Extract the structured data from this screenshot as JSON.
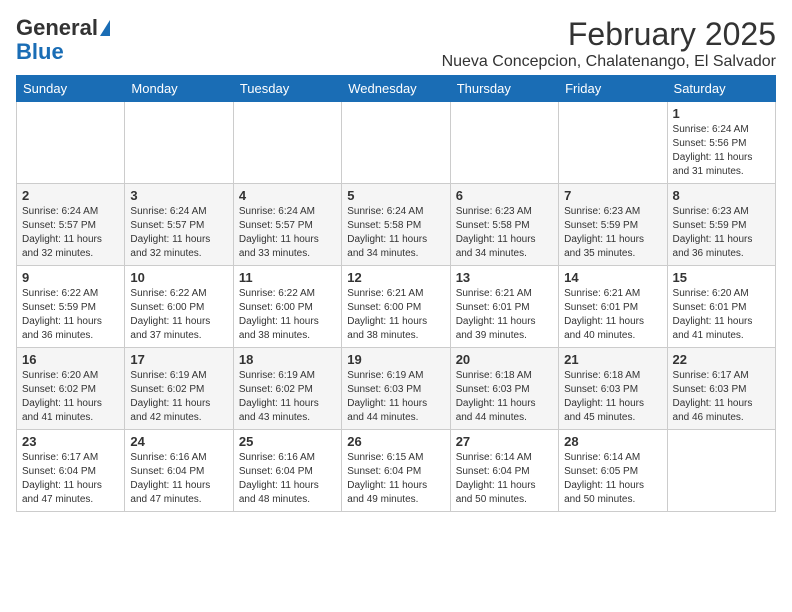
{
  "logo": {
    "general": "General",
    "blue": "Blue",
    "triangle": "▶"
  },
  "title": {
    "month": "February 2025",
    "location": "Nueva Concepcion, Chalatenango, El Salvador"
  },
  "headers": [
    "Sunday",
    "Monday",
    "Tuesday",
    "Wednesday",
    "Thursday",
    "Friday",
    "Saturday"
  ],
  "weeks": [
    [
      {
        "day": "",
        "info": ""
      },
      {
        "day": "",
        "info": ""
      },
      {
        "day": "",
        "info": ""
      },
      {
        "day": "",
        "info": ""
      },
      {
        "day": "",
        "info": ""
      },
      {
        "day": "",
        "info": ""
      },
      {
        "day": "1",
        "info": "Sunrise: 6:24 AM\nSunset: 5:56 PM\nDaylight: 11 hours and 31 minutes."
      }
    ],
    [
      {
        "day": "2",
        "info": "Sunrise: 6:24 AM\nSunset: 5:57 PM\nDaylight: 11 hours and 32 minutes."
      },
      {
        "day": "3",
        "info": "Sunrise: 6:24 AM\nSunset: 5:57 PM\nDaylight: 11 hours and 32 minutes."
      },
      {
        "day": "4",
        "info": "Sunrise: 6:24 AM\nSunset: 5:57 PM\nDaylight: 11 hours and 33 minutes."
      },
      {
        "day": "5",
        "info": "Sunrise: 6:24 AM\nSunset: 5:58 PM\nDaylight: 11 hours and 34 minutes."
      },
      {
        "day": "6",
        "info": "Sunrise: 6:23 AM\nSunset: 5:58 PM\nDaylight: 11 hours and 34 minutes."
      },
      {
        "day": "7",
        "info": "Sunrise: 6:23 AM\nSunset: 5:59 PM\nDaylight: 11 hours and 35 minutes."
      },
      {
        "day": "8",
        "info": "Sunrise: 6:23 AM\nSunset: 5:59 PM\nDaylight: 11 hours and 36 minutes."
      }
    ],
    [
      {
        "day": "9",
        "info": "Sunrise: 6:22 AM\nSunset: 5:59 PM\nDaylight: 11 hours and 36 minutes."
      },
      {
        "day": "10",
        "info": "Sunrise: 6:22 AM\nSunset: 6:00 PM\nDaylight: 11 hours and 37 minutes."
      },
      {
        "day": "11",
        "info": "Sunrise: 6:22 AM\nSunset: 6:00 PM\nDaylight: 11 hours and 38 minutes."
      },
      {
        "day": "12",
        "info": "Sunrise: 6:21 AM\nSunset: 6:00 PM\nDaylight: 11 hours and 38 minutes."
      },
      {
        "day": "13",
        "info": "Sunrise: 6:21 AM\nSunset: 6:01 PM\nDaylight: 11 hours and 39 minutes."
      },
      {
        "day": "14",
        "info": "Sunrise: 6:21 AM\nSunset: 6:01 PM\nDaylight: 11 hours and 40 minutes."
      },
      {
        "day": "15",
        "info": "Sunrise: 6:20 AM\nSunset: 6:01 PM\nDaylight: 11 hours and 41 minutes."
      }
    ],
    [
      {
        "day": "16",
        "info": "Sunrise: 6:20 AM\nSunset: 6:02 PM\nDaylight: 11 hours and 41 minutes."
      },
      {
        "day": "17",
        "info": "Sunrise: 6:19 AM\nSunset: 6:02 PM\nDaylight: 11 hours and 42 minutes."
      },
      {
        "day": "18",
        "info": "Sunrise: 6:19 AM\nSunset: 6:02 PM\nDaylight: 11 hours and 43 minutes."
      },
      {
        "day": "19",
        "info": "Sunrise: 6:19 AM\nSunset: 6:03 PM\nDaylight: 11 hours and 44 minutes."
      },
      {
        "day": "20",
        "info": "Sunrise: 6:18 AM\nSunset: 6:03 PM\nDaylight: 11 hours and 44 minutes."
      },
      {
        "day": "21",
        "info": "Sunrise: 6:18 AM\nSunset: 6:03 PM\nDaylight: 11 hours and 45 minutes."
      },
      {
        "day": "22",
        "info": "Sunrise: 6:17 AM\nSunset: 6:03 PM\nDaylight: 11 hours and 46 minutes."
      }
    ],
    [
      {
        "day": "23",
        "info": "Sunrise: 6:17 AM\nSunset: 6:04 PM\nDaylight: 11 hours and 47 minutes."
      },
      {
        "day": "24",
        "info": "Sunrise: 6:16 AM\nSunset: 6:04 PM\nDaylight: 11 hours and 47 minutes."
      },
      {
        "day": "25",
        "info": "Sunrise: 6:16 AM\nSunset: 6:04 PM\nDaylight: 11 hours and 48 minutes."
      },
      {
        "day": "26",
        "info": "Sunrise: 6:15 AM\nSunset: 6:04 PM\nDaylight: 11 hours and 49 minutes."
      },
      {
        "day": "27",
        "info": "Sunrise: 6:14 AM\nSunset: 6:04 PM\nDaylight: 11 hours and 50 minutes."
      },
      {
        "day": "28",
        "info": "Sunrise: 6:14 AM\nSunset: 6:05 PM\nDaylight: 11 hours and 50 minutes."
      },
      {
        "day": "",
        "info": ""
      }
    ]
  ]
}
